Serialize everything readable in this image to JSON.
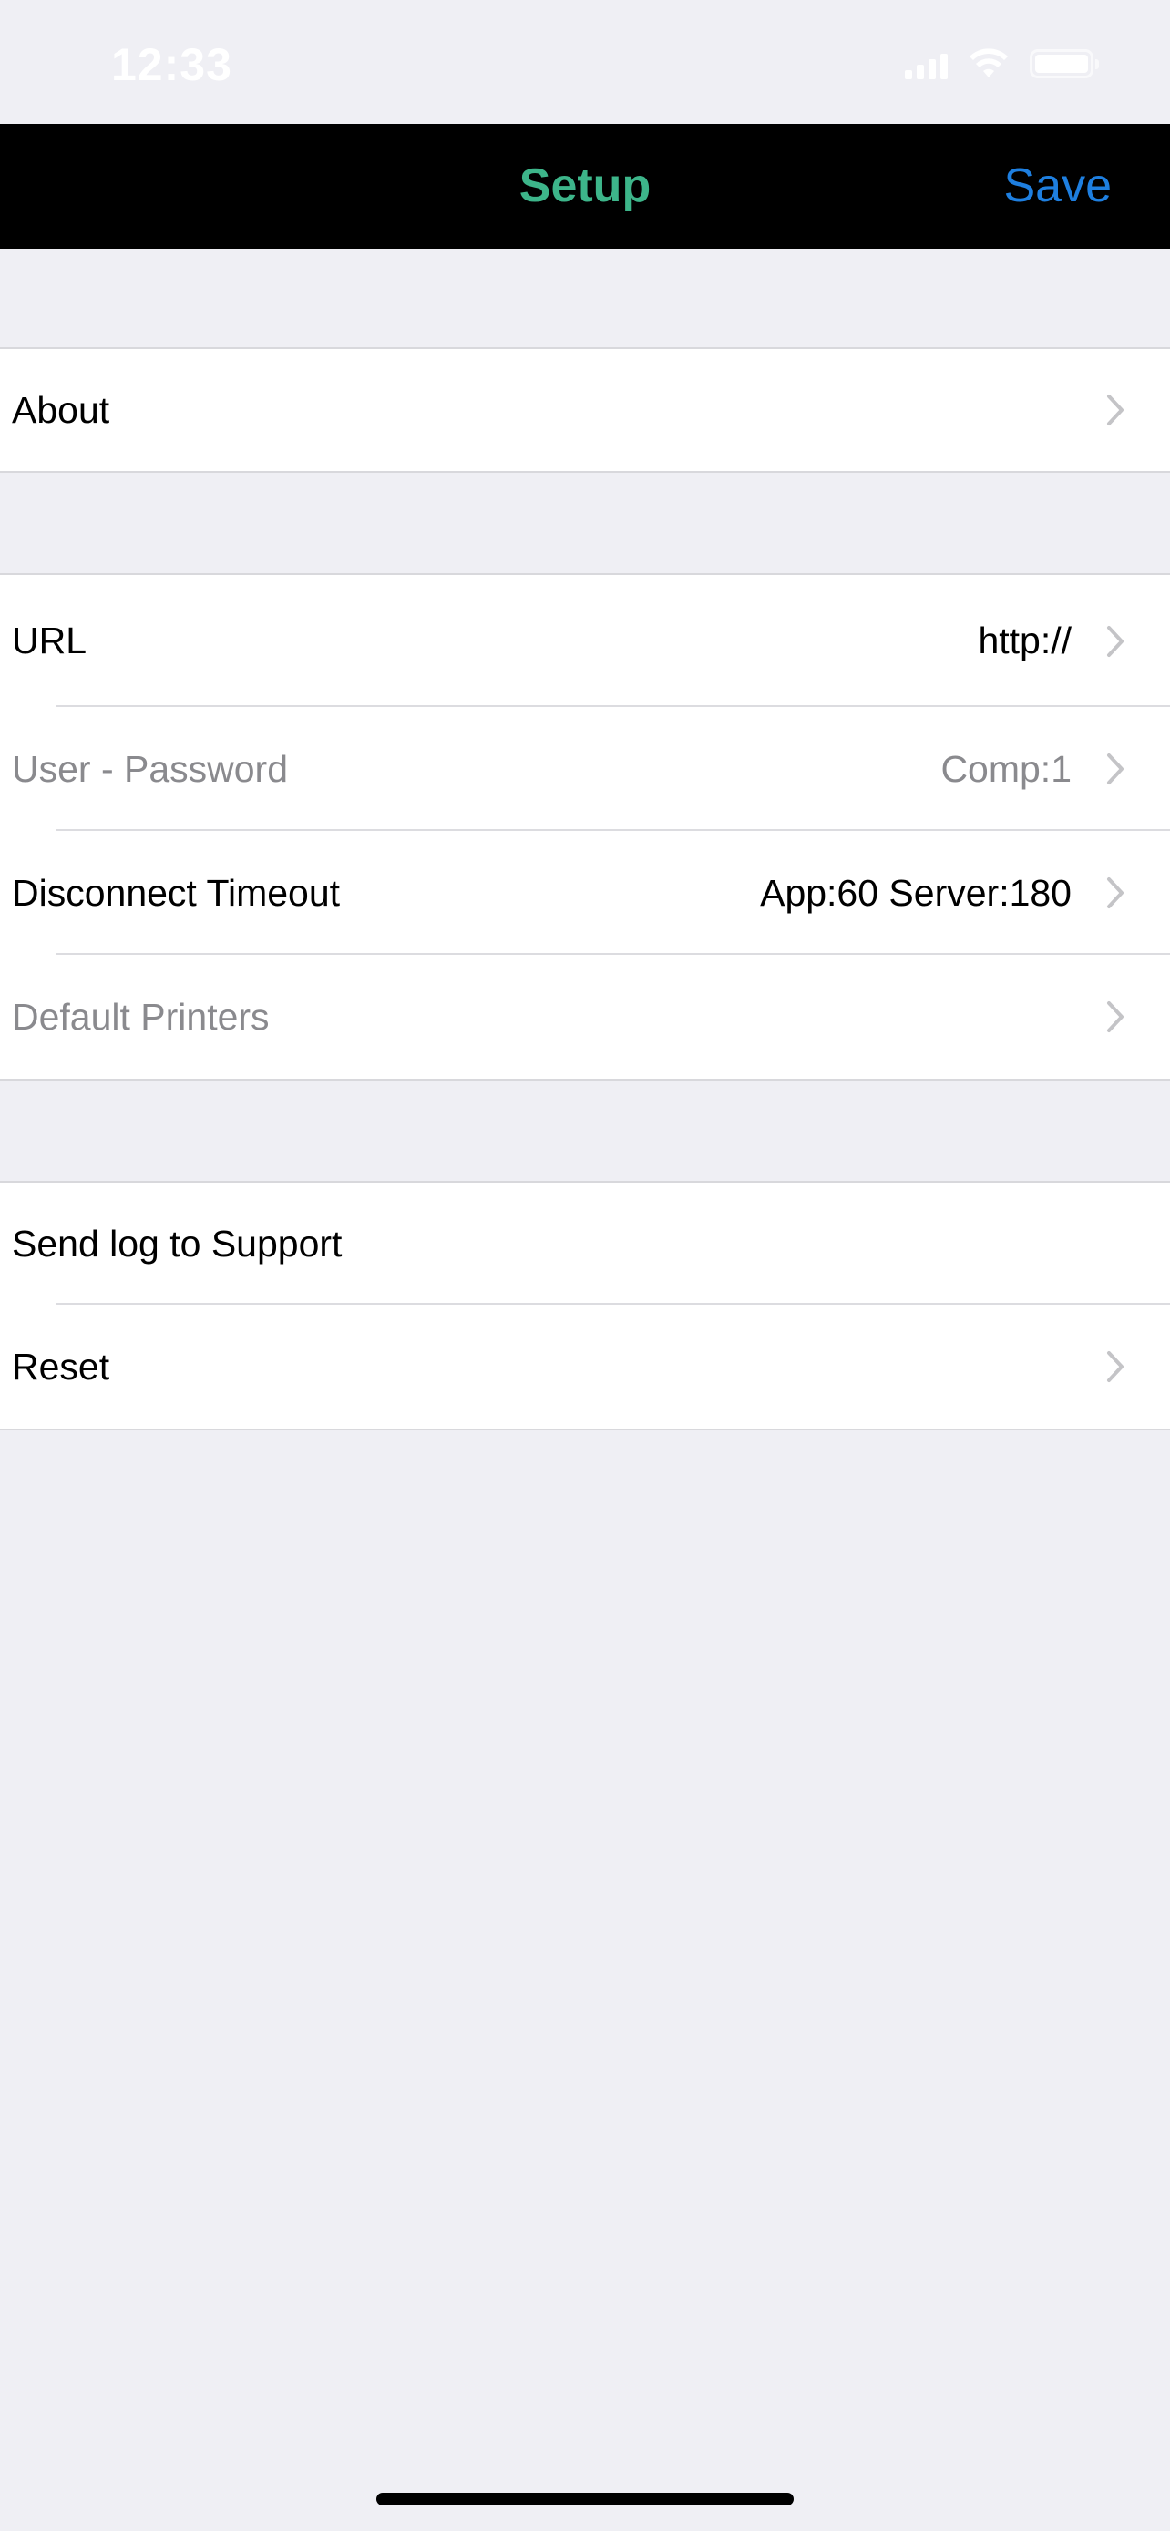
{
  "status_bar": {
    "time": "12:33",
    "icons": [
      "signal-icon",
      "wifi-icon",
      "battery-icon"
    ]
  },
  "nav": {
    "title": "Setup",
    "save_label": "Save",
    "title_color": "#3db58a",
    "save_color": "#1e7fe0"
  },
  "sections": {
    "about": {
      "label": "About"
    },
    "connection": {
      "url": {
        "label": "URL",
        "value": "http://"
      },
      "user_password": {
        "label": "User - Password",
        "value": "Comp:1"
      },
      "disconnect_timeout": {
        "label": "Disconnect Timeout",
        "value": "App:60 Server:180"
      },
      "default_printers": {
        "label": "Default Printers",
        "value": ""
      }
    },
    "support": {
      "send_log": {
        "label": "Send log to Support"
      },
      "reset": {
        "label": "Reset"
      }
    }
  }
}
